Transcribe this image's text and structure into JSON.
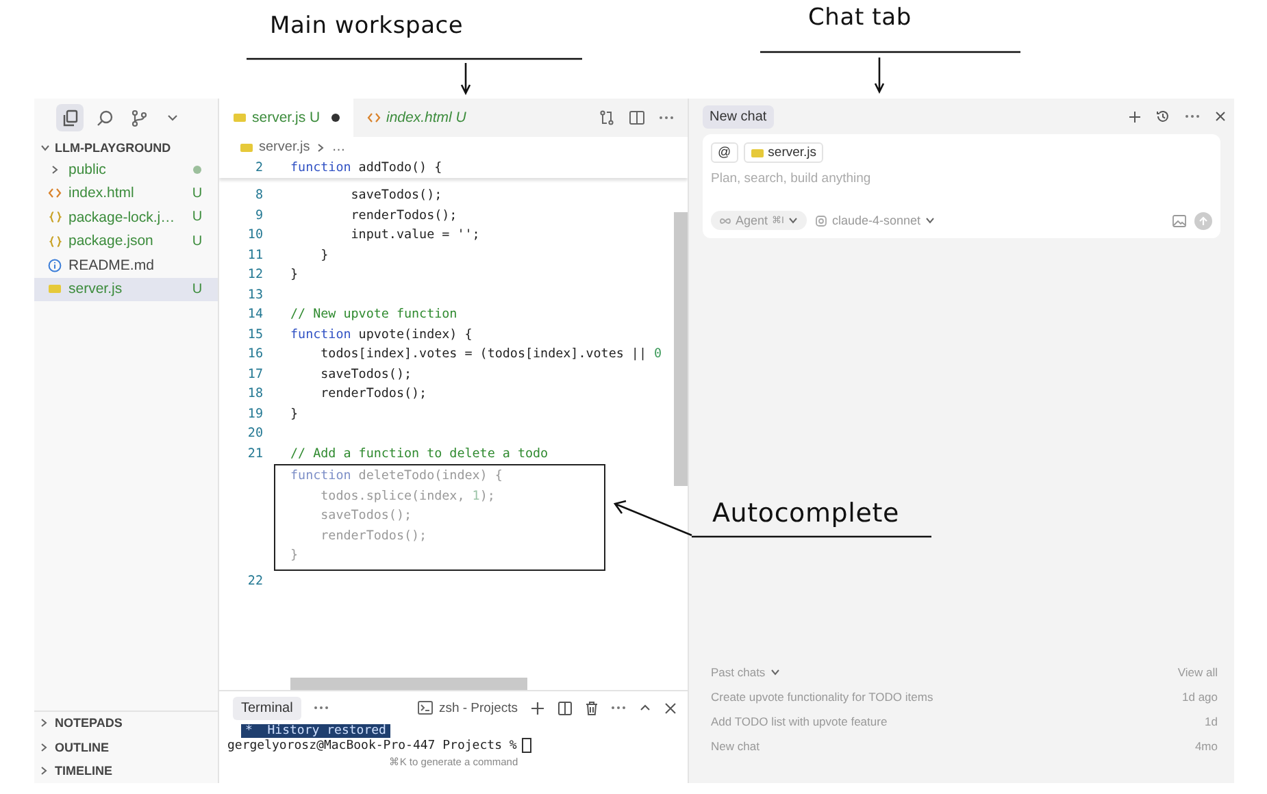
{
  "annotations": [
    {
      "kind": "header",
      "text": "Main workspace"
    },
    {
      "kind": "header",
      "text": "Chat tab"
    },
    {
      "kind": "callout",
      "text": "Autocomplete"
    }
  ],
  "activity_bar": [
    {
      "kind": "files",
      "selected": true
    },
    {
      "kind": "search",
      "selected": false
    },
    {
      "kind": "source-control",
      "selected": false
    },
    {
      "kind": "chevron",
      "selected": false
    }
  ],
  "explorer": {
    "title": "LLM-PLAYGROUND",
    "expanded": true,
    "items": [
      {
        "kind": "folder",
        "name": "public",
        "expanded": false,
        "dot": true,
        "untracked": true,
        "selected": false
      },
      {
        "kind": "html",
        "name": "index.html",
        "status": "U",
        "dot": false,
        "untracked": true,
        "selected": false
      },
      {
        "kind": "json",
        "name": "package-lock.j…",
        "status": "U",
        "dot": false,
        "untracked": true,
        "selected": false
      },
      {
        "kind": "json",
        "name": "package.json",
        "status": "U",
        "dot": false,
        "untracked": true,
        "selected": false
      },
      {
        "kind": "info",
        "name": "README.md",
        "dot": false,
        "untracked": false,
        "selected": false
      },
      {
        "kind": "js",
        "name": "server.js",
        "status": "U",
        "dot": false,
        "untracked": true,
        "selected": true
      }
    ]
  },
  "sections": [
    {
      "title": "NOTEPADS",
      "expanded": false
    },
    {
      "title": "OUTLINE",
      "expanded": false
    },
    {
      "title": "TIMELINE",
      "expanded": false
    }
  ],
  "editor": {
    "tabs": [
      {
        "kind": "js",
        "label": "server.js",
        "status": "U",
        "modified": true,
        "preview": false,
        "selected": true
      },
      {
        "kind": "html",
        "label": "index.html",
        "status": "U",
        "modified": false,
        "preview": true,
        "selected": false
      }
    ],
    "breadcrumb": [
      {
        "kind": "file",
        "text": "server.js"
      },
      {
        "kind": "symbol",
        "text": "…"
      }
    ],
    "sticky_line": {
      "number": "2",
      "tokens": [
        {
          "kind": "keyword",
          "text": "function"
        },
        {
          "kind": "plain",
          "text": " addTodo() {"
        }
      ]
    },
    "lines": [
      {
        "kind": "code",
        "number": "8",
        "tokens": [
          {
            "kind": "plain",
            "text": "        saveTodos();"
          }
        ]
      },
      {
        "kind": "code",
        "number": "9",
        "tokens": [
          {
            "kind": "plain",
            "text": "        renderTodos();"
          }
        ]
      },
      {
        "kind": "code",
        "number": "10",
        "tokens": [
          {
            "kind": "plain",
            "text": "        input.value = '';"
          }
        ]
      },
      {
        "kind": "code",
        "number": "11",
        "tokens": [
          {
            "kind": "plain",
            "text": "    }"
          }
        ]
      },
      {
        "kind": "code",
        "number": "12",
        "tokens": [
          {
            "kind": "plain",
            "text": "}"
          }
        ]
      },
      {
        "kind": "code",
        "number": "13"
      },
      {
        "kind": "code",
        "number": "14",
        "tokens": [
          {
            "kind": "comment",
            "text": "// New upvote function"
          }
        ]
      },
      {
        "kind": "code",
        "number": "15",
        "tokens": [
          {
            "kind": "keyword",
            "text": "function"
          },
          {
            "kind": "plain",
            "text": " upvote(index) {"
          }
        ]
      },
      {
        "kind": "code",
        "number": "16",
        "tokens": [
          {
            "kind": "plain",
            "text": "    todos[index].votes = (todos[index].votes || "
          },
          {
            "kind": "number",
            "text": "0"
          }
        ]
      },
      {
        "kind": "code",
        "number": "17",
        "tokens": [
          {
            "kind": "plain",
            "text": "    saveTodos();"
          }
        ]
      },
      {
        "kind": "code",
        "number": "18",
        "tokens": [
          {
            "kind": "plain",
            "text": "    renderTodos();"
          }
        ]
      },
      {
        "kind": "code",
        "number": "19",
        "tokens": [
          {
            "kind": "plain",
            "text": "}"
          }
        ]
      },
      {
        "kind": "code",
        "number": "20"
      },
      {
        "kind": "code",
        "number": "21",
        "tokens": [
          {
            "kind": "comment",
            "text": "// Add a function to delete a todo"
          }
        ]
      },
      {
        "kind": "ghost",
        "tokens": [
          {
            "kind": "keyword",
            "text": "function"
          },
          {
            "kind": "plain",
            "text": " deleteTodo(index) {"
          }
        ]
      },
      {
        "kind": "ghost",
        "tokens": [
          {
            "kind": "plain",
            "text": "    todos.splice(index, "
          },
          {
            "kind": "number",
            "text": "1"
          },
          {
            "kind": "plain",
            "text": ");"
          }
        ]
      },
      {
        "kind": "ghost",
        "tokens": [
          {
            "kind": "plain",
            "text": "    saveTodos();"
          }
        ]
      },
      {
        "kind": "ghost",
        "tokens": [
          {
            "kind": "plain",
            "text": "    renderTodos();"
          }
        ]
      },
      {
        "kind": "ghost",
        "tokens": [
          {
            "kind": "plain",
            "text": "}"
          }
        ]
      },
      {
        "kind": "code",
        "number": "22"
      }
    ]
  },
  "terminal": {
    "tabs": [
      {
        "label": "Terminal",
        "selected": true
      }
    ],
    "shell": "zsh - Projects",
    "lines": [
      {
        "kind": "banner",
        "text": "*  History restored"
      },
      {
        "kind": "prompt",
        "text": "gergelyorosz@MacBook-Pro-447 Projects %"
      }
    ],
    "hint": "⌘K to generate a command"
  },
  "chat": {
    "tabs": [
      {
        "label": "New chat",
        "selected": true
      }
    ],
    "context_chips": [
      {
        "kind": "mention",
        "text": "@"
      },
      {
        "kind": "file",
        "text": "server.js"
      }
    ],
    "placeholder": "Plan, search, build anything",
    "mode": {
      "label": "Agent",
      "shortcut": "⌘I"
    },
    "model": "claude-4-sonnet",
    "past_chats": {
      "title": "Past chats",
      "view_all": "View all",
      "items": [
        {
          "title": "Create upvote functionality for TODO items",
          "time": "1d ago"
        },
        {
          "title": "Add TODO list with upvote feature",
          "time": "1d"
        },
        {
          "title": "New chat",
          "time": "4mo"
        }
      ]
    }
  }
}
